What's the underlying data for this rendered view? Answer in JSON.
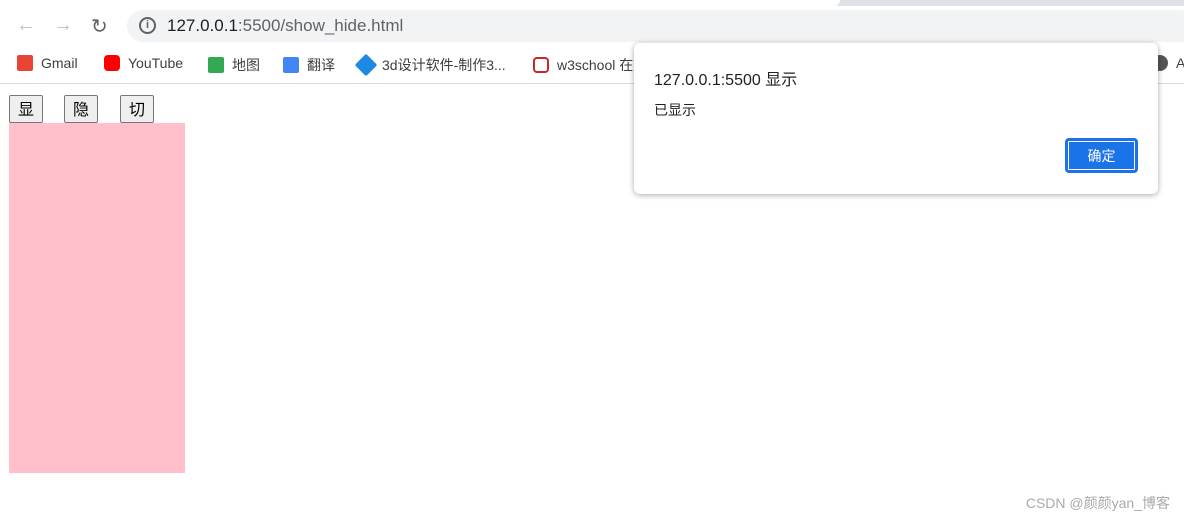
{
  "browser": {
    "url_host": "127.0.0.1",
    "url_rest": ":5500/show_hide.html",
    "nav_icons": [
      "back-icon",
      "forward-icon",
      "reload-icon"
    ],
    "bookmarks": [
      {
        "label": "Gmail",
        "color": "#ea4335"
      },
      {
        "label": "YouTube",
        "color": "#ff0000"
      },
      {
        "label": "地图",
        "color": "#34a853"
      },
      {
        "label": "翻译",
        "color": "#4285f4"
      },
      {
        "label": "3d设计软件-制作3...",
        "color": "#1e88e5"
      },
      {
        "label": "w3school 在",
        "color": "#c62828"
      },
      {
        "label": "A",
        "color": "#555555"
      }
    ]
  },
  "page": {
    "buttons": [
      "显示",
      "隐藏",
      "切换"
    ],
    "box_color": "#ffc0cb"
  },
  "dialog": {
    "title": "127.0.0.1:5500 显示",
    "message": "已显示",
    "ok_label": "确定"
  },
  "watermark": "CSDN @颜颜yan_博客"
}
